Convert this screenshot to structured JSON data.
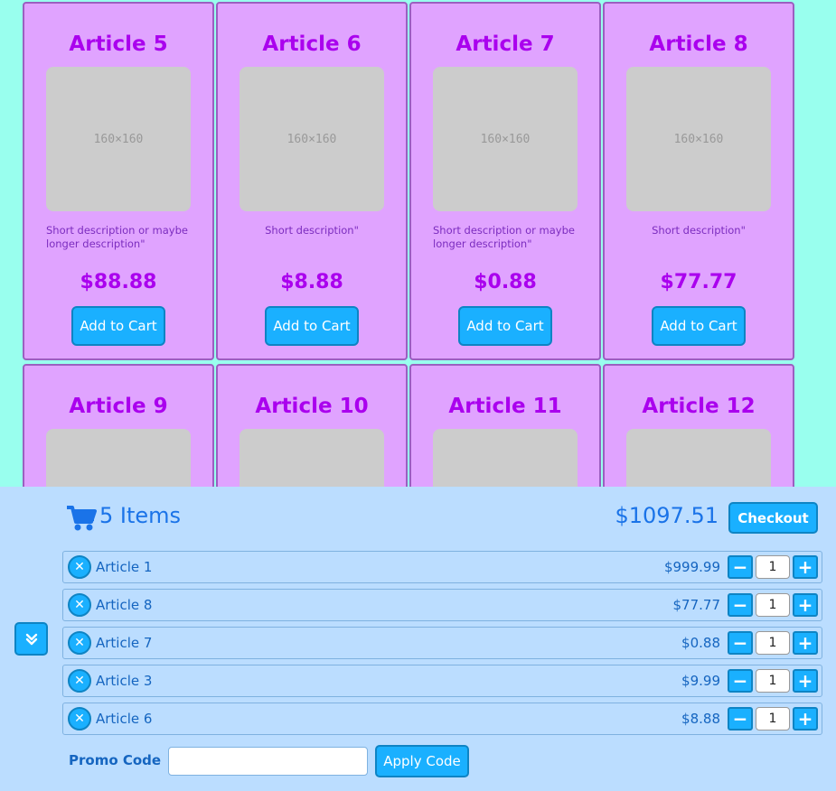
{
  "products": [
    {
      "title": "Article 5",
      "image_label": "160×160",
      "description": "Short description or maybe longer description\"",
      "price": "$88.88",
      "button": "Add to Cart"
    },
    {
      "title": "Article 6",
      "image_label": "160×160",
      "description": "Short description\"",
      "price": "$8.88",
      "button": "Add to Cart"
    },
    {
      "title": "Article 7",
      "image_label": "160×160",
      "description": "Short description or maybe longer description\"",
      "price": "$0.88",
      "button": "Add to Cart"
    },
    {
      "title": "Article 8",
      "image_label": "160×160",
      "description": "Short description\"",
      "price": "$77.77",
      "button": "Add to Cart"
    },
    {
      "title": "Article 9"
    },
    {
      "title": "Article 10"
    },
    {
      "title": "Article 11"
    },
    {
      "title": "Article 12"
    }
  ],
  "cart": {
    "icon": "shopping-cart-icon",
    "item_count": "5 Items",
    "total": "$1097.51",
    "checkout_label": "Checkout",
    "collapse_icon": "double-chevron-down-icon",
    "items": [
      {
        "name": "Article 1",
        "price": "$999.99",
        "qty": "1"
      },
      {
        "name": "Article 8",
        "price": "$77.77",
        "qty": "1"
      },
      {
        "name": "Article 7",
        "price": "$0.88",
        "qty": "1"
      },
      {
        "name": "Article 3",
        "price": "$9.99",
        "qty": "1"
      },
      {
        "name": "Article 6",
        "price": "$8.88",
        "qty": "1"
      }
    ],
    "promo_label": "Promo Code",
    "promo_value": "",
    "apply_label": "Apply Code"
  },
  "colors": {
    "page_bg": "#99ffee",
    "card_bg": "#e0a3ff",
    "card_text": "#aa00ee",
    "button_bg": "#1ab0ff",
    "cart_bg": "#bbddff",
    "cart_text": "#1a73e8"
  }
}
